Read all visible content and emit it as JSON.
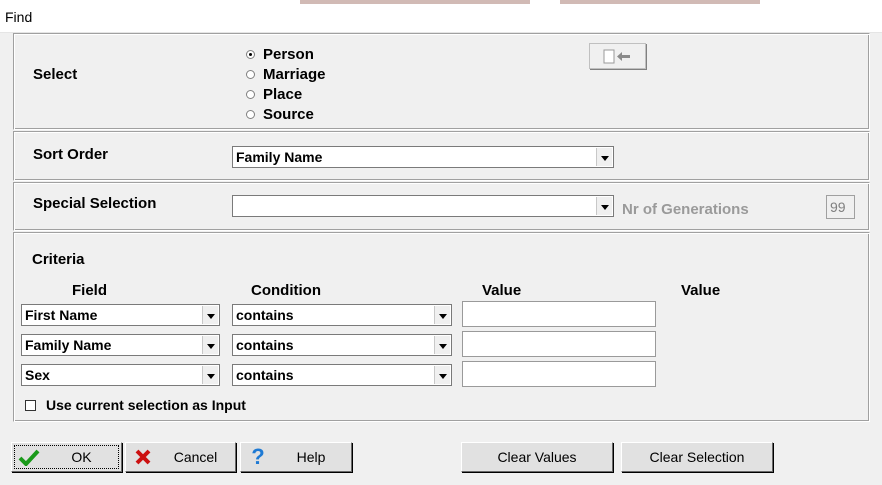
{
  "window": {
    "title": "Find"
  },
  "select": {
    "label": "Select",
    "options": [
      {
        "label": "Person",
        "selected": true
      },
      {
        "label": "Marriage",
        "selected": false
      },
      {
        "label": "Place",
        "selected": false
      },
      {
        "label": "Source",
        "selected": false
      }
    ]
  },
  "sort_order": {
    "label": "Sort Order",
    "value": "Family Name"
  },
  "special_selection": {
    "label": "Special Selection",
    "value": "",
    "generations_label": "Nr of Generations",
    "generations_value": "99"
  },
  "criteria": {
    "label": "Criteria",
    "headers": {
      "field": "Field",
      "condition": "Condition",
      "value": "Value",
      "value2": "Value"
    },
    "rows": [
      {
        "field": "First Name",
        "condition": "contains",
        "value": ""
      },
      {
        "field": "Family Name",
        "condition": "contains",
        "value": ""
      },
      {
        "field": "Sex",
        "condition": "contains",
        "value": ""
      }
    ],
    "use_current_selection_label": "Use current selection as Input"
  },
  "buttons": {
    "ok": "OK",
    "cancel": "Cancel",
    "help": "Help",
    "clear_values": "Clear Values",
    "clear_selection": "Clear Selection"
  }
}
